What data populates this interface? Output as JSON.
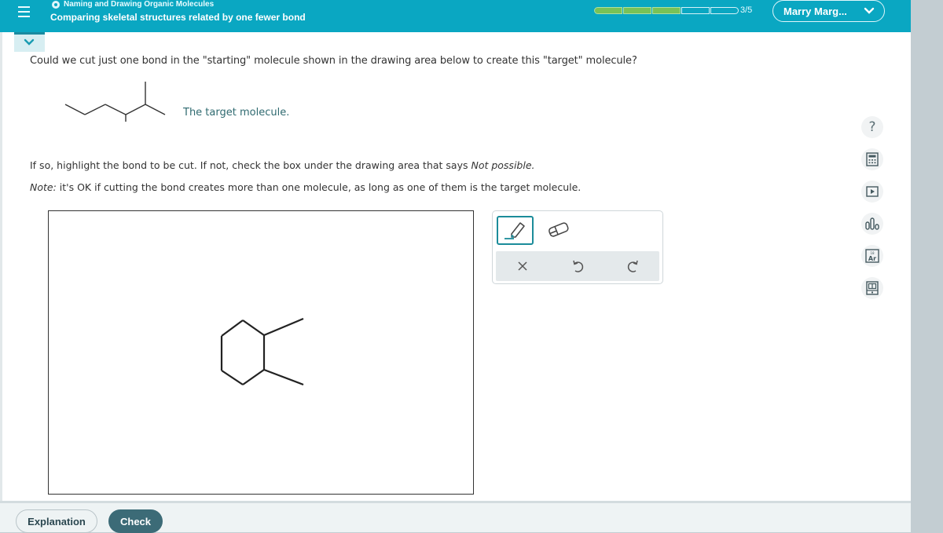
{
  "header": {
    "topic": "Naming and Drawing Organic Molecules",
    "subtitle": "Comparing skeletal structures related by one fewer bond",
    "progress": {
      "completed": 3,
      "total": 5,
      "label": "3/5"
    },
    "user_name": "Marry Marg...",
    "accent_color": "#0aa7c2"
  },
  "question": {
    "prompt": "Could we cut just one bond in the \"starting\" molecule shown in the drawing area below to create this \"target\" molecule?",
    "target_label": "The target molecule.",
    "instruction_prefix": "If so, highlight the bond to be cut. If not, check the box under the drawing area that says ",
    "instruction_italic": "Not possible.",
    "note_label": "Note:",
    "note_text": " it's OK if cutting the bond creates more than one molecule, as long as one of them is the target molecule."
  },
  "toolbox": {
    "tools": [
      {
        "name": "highlighter",
        "selected": true
      },
      {
        "name": "eraser",
        "selected": false
      }
    ],
    "actions": [
      "clear",
      "undo",
      "redo"
    ]
  },
  "side_tools": [
    "help",
    "calculator",
    "video",
    "data",
    "periodic-table",
    "reference"
  ],
  "footer": {
    "explanation_label": "Explanation",
    "check_label": "Check"
  }
}
